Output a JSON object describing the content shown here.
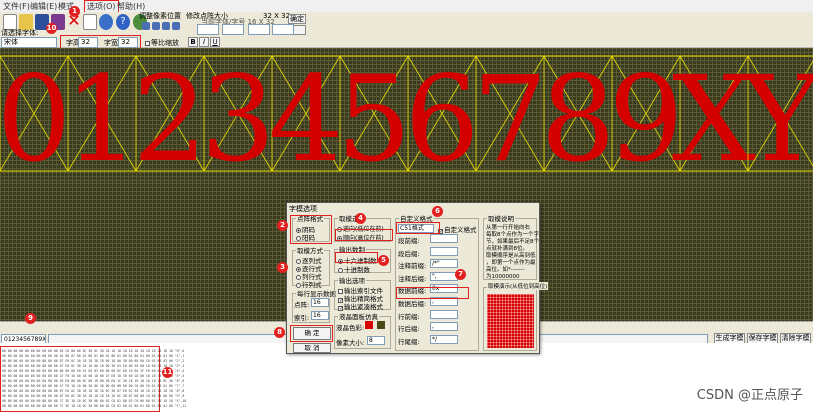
{
  "menubar": {
    "items": [
      {
        "label": "文件(F)"
      },
      {
        "label": "编辑(E)"
      },
      {
        "label": "模式"
      },
      {
        "label": "选项(O)"
      },
      {
        "label": "帮助(H)"
      }
    ]
  },
  "toolbar": {
    "adjust_pixel_label": "调整像素位置",
    "modify_size_label": "修改点阵大小",
    "size_readout": "32 X 32",
    "confirm_label": "确定",
    "font_select_label": "请选择字体:",
    "font_value": "宋体",
    "font_size_label": "字高",
    "font_size_value": "32",
    "char_height_label": "字宽",
    "char_height_value": "32",
    "proportional_label": "等比缩放",
    "current_font_label": "当前字体/字号 16 X 32",
    "bold_label": "B",
    "italic_label": "I",
    "underline_label": "U"
  },
  "canvas": {
    "glyphs": [
      "0",
      "1",
      "2",
      "3",
      "4",
      "5",
      "6",
      "7",
      "8",
      "9",
      "X",
      "Y"
    ]
  },
  "status": {
    "input_text": "0123456789XY",
    "generate_button": "生成字模",
    "save_button": "保存字模",
    "clear_button": "清除字模"
  },
  "dialog": {
    "title": "字模选项",
    "dot_format": {
      "title": "点阵格式",
      "options": [
        "阴码",
        "阳码"
      ],
      "selected": 0
    },
    "scan_mode": {
      "title": "取模方式",
      "options": [
        "逐列式",
        "逐行式",
        "列行式",
        "行列式"
      ],
      "selected": 1
    },
    "per_line": {
      "title": "每行显示数据",
      "dot_label": "点阵:",
      "dot_value": "16",
      "index_label": "索引:",
      "index_value": "16"
    },
    "bit_order": {
      "title": "取模走向",
      "options": [
        "逆向(低位在前)",
        "顺向(高位在前)"
      ],
      "selected": 1
    },
    "output_radix": {
      "title": "输出数制",
      "options": [
        "十六进制数",
        "十进制数"
      ],
      "selected": 0
    },
    "output_options": {
      "title": "输出选项",
      "options": [
        {
          "label": "输出索引文件",
          "checked": false
        },
        {
          "label": "输出精简格式",
          "checked": true
        },
        {
          "label": "输出紧凑格式",
          "checked": true
        }
      ]
    },
    "lcd_sim": {
      "title": "液晶面板仿真",
      "color_label": "液晶色彩:",
      "pixel_size_label": "像素大小:",
      "pixel_size_value": "8",
      "on_color": "#d80000",
      "off_color": "#4a4a18"
    },
    "custom_format": {
      "title": "自定义格式",
      "format_value": "C51格式",
      "custom_checkbox_label": "自定义格式",
      "custom_checked": true,
      "rows": [
        {
          "label": "段前缀:",
          "value": ""
        },
        {
          "label": "段后缀:",
          "value": ""
        },
        {
          "label": "注释前缀:",
          "value": "/*\""
        },
        {
          "label": "注释后缀:",
          "value": "\","
        },
        {
          "label": "数据前缀:",
          "value": "0x"
        },
        {
          "label": "数据后缀:",
          "value": ","
        },
        {
          "label": "行前缀:",
          "value": ""
        },
        {
          "label": "行后缀:",
          "value": ","
        },
        {
          "label": "行尾缀:",
          "value": "*/"
        }
      ]
    },
    "mode_note": {
      "title": "取模说明",
      "lines": [
        "从第一行开始向右",
        "每取8个点作为一个字",
        "节，如果最后不足8个",
        "点就补满到8位。",
        "取模顺序是从高到低",
        "，即第一个点作为最",
        "高位。如*-------",
        "为10000000"
      ]
    },
    "preview_title": "取模演示(从低位到高位)",
    "ok_button": "确 定",
    "cancel_button": "取 消"
  },
  "callouts": [
    "1",
    "2",
    "3",
    "4",
    "5",
    "6",
    "7",
    "8",
    "9",
    "10",
    "11"
  ],
  "output": {
    "lines": [
      "00 00 00 00 00 00 00 00 00 00 03 C0 06 60 0C 30 0C 30 18 18 18 18 18 18 18 18 18 18 18 18 \"0\",0",
      "00 00 00 00 00 00 00 00 00 00 01 80 07 80 01 80 01 80 01 80 01 80 01 80 01 80 01 80 01 80 \"1\",1",
      "00 00 00 00 00 00 00 00 00 00 07 E0 0C 30 18 18 18 18 00 18 00 30 00 60 00 C0 01 80 03 00 \"2\",2",
      "00 00 00 00 00 00 00 00 00 00 07 E0 0C 30 18 18 00 18 00 30 03 E0 00 30 00 18 00 18 18 18 \"3\",3",
      "00 00 00 00 00 00 00 00 00 00 00 60 00 E0 01 E0 03 60 06 60 0C 60 18 60 1F F8 00 60 00 60 \"4\",4",
      "00 00 00 00 00 00 00 00 00 00 1F F8 18 00 18 00 18 00 1F E0 18 30 00 18 00 18 18 18 18 30 \"5\",5",
      "00 00 00 00 00 00 00 00 00 00 03 E0 06 00 0C 00 18 00 1B E0 1C 30 18 18 18 18 18 18 0C 30 \"6\",6",
      "00 00 00 00 00 00 00 00 00 00 1F F8 18 18 00 30 00 30 00 60 00 60 00 C0 00 C0 01 80 01 80 \"7\",7",
      "00 00 00 00 00 00 00 00 00 00 07 E0 0C 30 18 18 18 18 0C 30 07 E0 0C 30 18 18 18 18 18 18 \"8\",8",
      "00 00 00 00 00 00 00 00 00 00 07 E0 0C 30 18 18 18 18 18 18 0C 38 07 D8 00 18 00 30 00 60 \"9\",9",
      "00 00 00 00 00 00 00 00 00 00 7C 3E 18 18 0C 30 06 60 03 C0 01 80 03 C0 06 60 0C 30 18 18 \"X\",10",
      "00 00 00 00 00 00 00 00 00 00 7C 3E 18 18 0C 30 06 60 03 C0 01 80 01 80 01 80 01 80 01 80 \"Y\",11"
    ]
  },
  "watermark": "CSDN @正点原子",
  "colors": {
    "glyph": "#d40000",
    "grid_bg": "#3a3a1e",
    "callout": "#e32020",
    "guide": "#e8e000"
  }
}
